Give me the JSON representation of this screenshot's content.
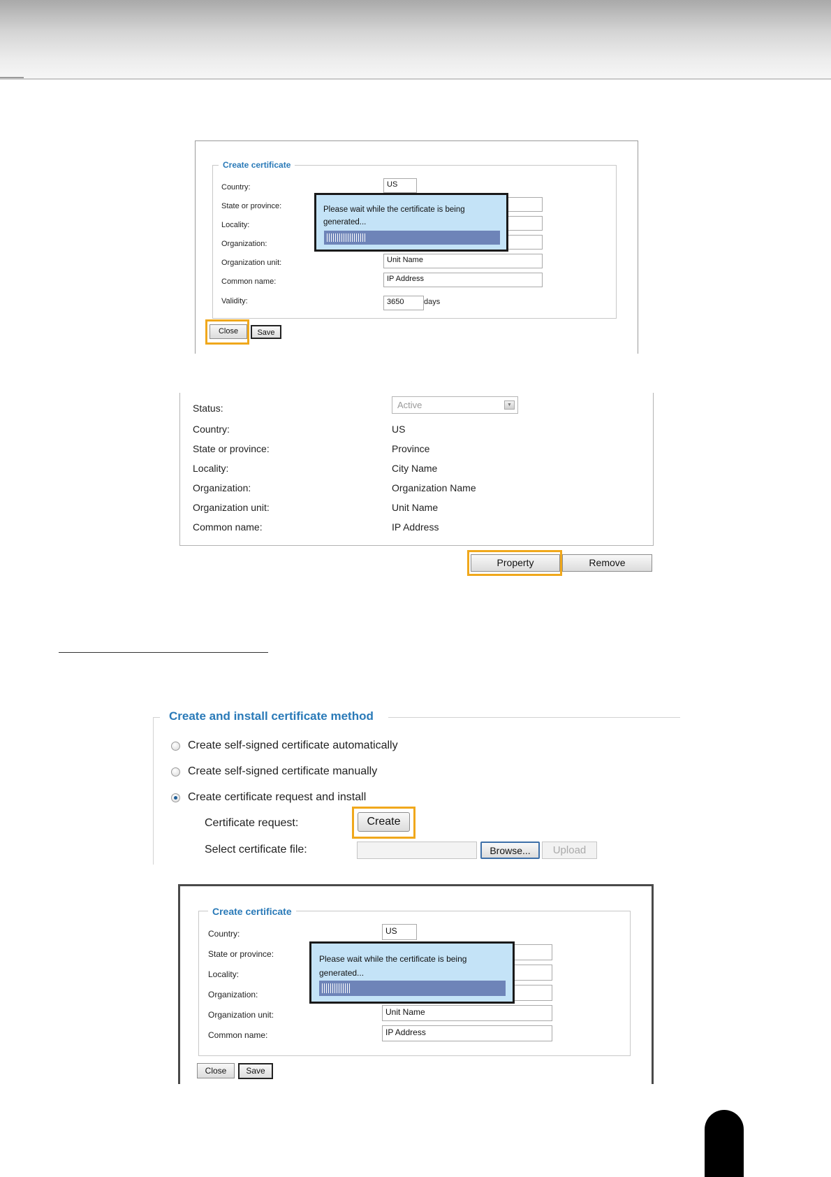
{
  "create_certificate_top": {
    "legend": "Create certificate",
    "labels": [
      "Country:",
      "State or province:",
      "Locality:",
      "Organization:",
      "Organization unit:",
      "Common name:",
      "Validity:"
    ],
    "country_value": "US",
    "org_unit_value": "Unit Name",
    "common_name_value": "IP Address",
    "validity_value": "3650",
    "validity_unit": "days",
    "wait_message": "Please wait while the certificate is being generated...",
    "close_label": "Close",
    "save_label": "Save"
  },
  "certificate_info": {
    "status_label": "Status:",
    "status_value": "Active",
    "rows": [
      {
        "label": "Country:",
        "value": "US"
      },
      {
        "label": "State or province:",
        "value": "Province"
      },
      {
        "label": "Locality:",
        "value": "City Name"
      },
      {
        "label": "Organization:",
        "value": "Organization Name"
      },
      {
        "label": "Organization unit:",
        "value": "Unit Name"
      },
      {
        "label": "Common name:",
        "value": "IP Address"
      }
    ],
    "property_label": "Property",
    "remove_label": "Remove"
  },
  "install_method": {
    "legend": "Create and install certificate method",
    "options": [
      {
        "label": "Create self-signed certificate automatically",
        "checked": false
      },
      {
        "label": "Create self-signed certificate manually",
        "checked": false
      },
      {
        "label": "Create certificate request and install",
        "checked": true
      }
    ],
    "certificate_request_label": "Certificate request:",
    "create_label": "Create",
    "select_file_label": "Select certificate file:",
    "browse_label": "Browse...",
    "upload_label": "Upload"
  },
  "create_certificate_bottom": {
    "legend": "Create certificate",
    "labels": [
      "Country:",
      "State or province:",
      "Locality:",
      "Organization:",
      "Organization unit:",
      "Common name:"
    ],
    "country_value": "US",
    "org_unit_value": "Unit Name",
    "common_name_value": "IP Address",
    "wait_message": "Please wait while the certificate is being generated...",
    "close_label": "Close",
    "save_label": "Save"
  },
  "progress": {
    "top_fraction": 0.22,
    "bottom_fraction": 0.15
  },
  "colors": {
    "legend_blue": "#2a7ab8",
    "highlight_orange": "#f0a81c",
    "dialog_bg": "#c4e3f7",
    "progress_bar": "#6e84b8"
  }
}
